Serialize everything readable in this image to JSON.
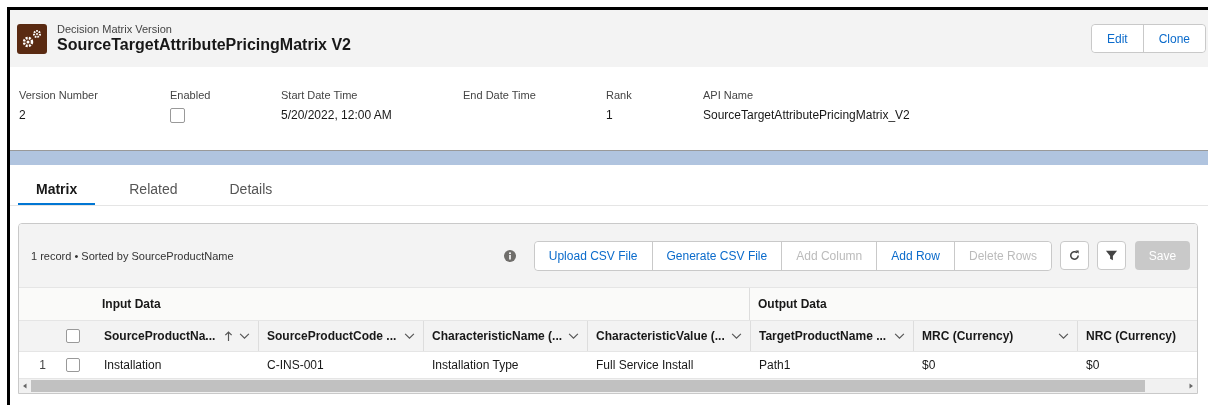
{
  "header": {
    "object_type": "Decision Matrix Version",
    "title": "SourceTargetAttributePricingMatrix V2",
    "actions": [
      "Edit",
      "Clone"
    ]
  },
  "fields": [
    {
      "label": "Version Number",
      "kind": "text",
      "value": "2"
    },
    {
      "label": "Enabled",
      "kind": "checkbox",
      "checked": false
    },
    {
      "label": "Start Date Time",
      "kind": "text",
      "value": "5/20/2022, 12:00 AM"
    },
    {
      "label": "End Date Time",
      "kind": "text"
    },
    {
      "label": "Rank",
      "kind": "text",
      "value": "1"
    },
    {
      "label": "API Name",
      "kind": "text",
      "value": "SourceTargetAttributePricingMatrix_V2"
    }
  ],
  "tabs": [
    {
      "label": "Matrix",
      "selected": true
    },
    {
      "label": "Related",
      "selected": false
    },
    {
      "label": "Details",
      "selected": false
    }
  ],
  "table": {
    "summary": "1 record • Sorted by SourceProductName",
    "toolbar": [
      {
        "label": "Upload CSV File",
        "disabled": false
      },
      {
        "label": "Generate CSV File",
        "disabled": false
      },
      {
        "label": "Add Column",
        "disabled": true
      },
      {
        "label": "Add Row",
        "disabled": false
      },
      {
        "label": "Delete Rows",
        "disabled": true
      }
    ],
    "save": {
      "label": "Save",
      "disabled": true
    },
    "all_selected": false,
    "groups": [
      {
        "label": "Input Data"
      },
      {
        "label": "Output Data"
      }
    ],
    "columns": [
      {
        "label": "SourceProductNa...",
        "sorted": true,
        "menu": true
      },
      {
        "label": "SourceProductCode ...",
        "sorted": false,
        "menu": true
      },
      {
        "label": "CharacteristicName (...",
        "sorted": false,
        "menu": true
      },
      {
        "label": "CharacteristicValue (...",
        "sorted": false,
        "menu": true
      },
      {
        "label": "TargetProductName ...",
        "sorted": false,
        "menu": true
      },
      {
        "label": "MRC (Currency)",
        "sorted": false,
        "menu": true
      },
      {
        "label": "NRC (Currency)",
        "sorted": false,
        "menu": false
      }
    ],
    "rows": [
      {
        "number": "1",
        "selected": false,
        "cells": [
          "Installation",
          "C-INS-001",
          "Installation Type",
          "Full Service Install",
          "Path1",
          "$0",
          "$0"
        ]
      }
    ]
  }
}
